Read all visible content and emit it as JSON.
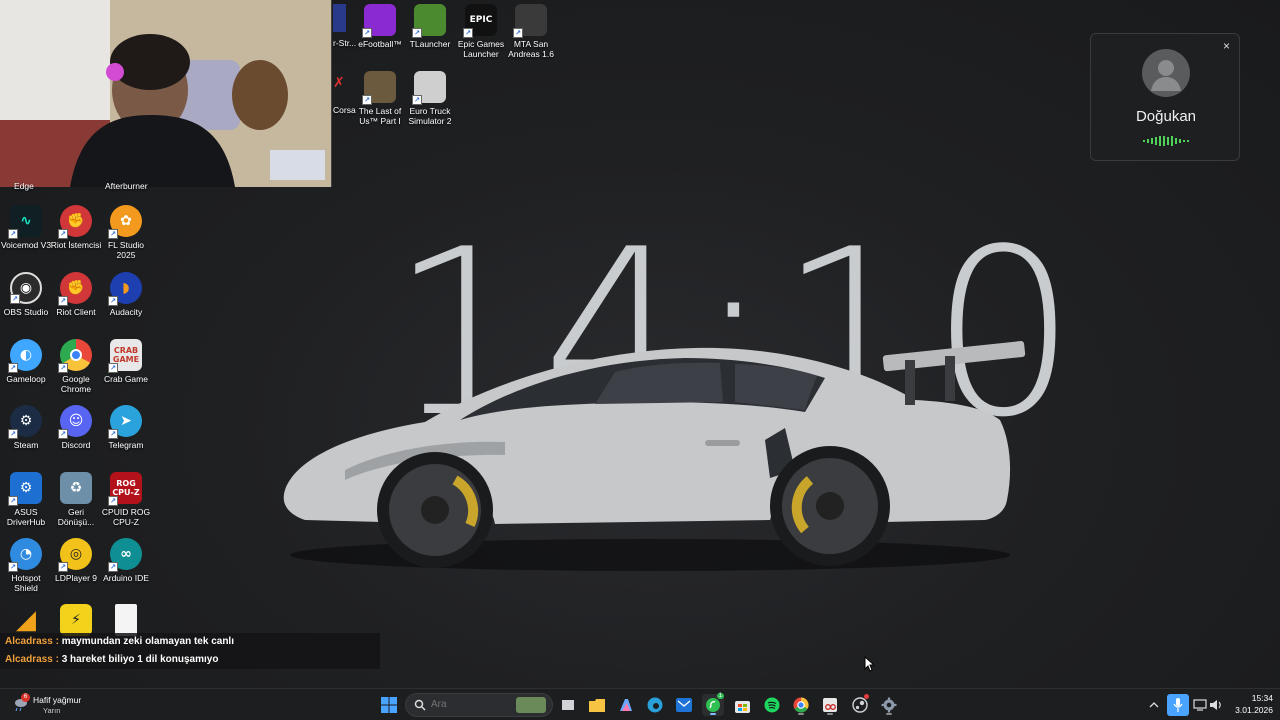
{
  "wallpaper": {
    "clock_text": "14:10"
  },
  "webcam": {
    "label": "webcam-overlay"
  },
  "desktop_icons": [
    {
      "id": "efootball",
      "label": "eFootball™",
      "color": "#8a2bd2"
    },
    {
      "id": "tlauncher",
      "label": "TLauncher",
      "color": "#4c8a2f"
    },
    {
      "id": "epic",
      "label": "Epic Games Launcher",
      "color": "#111111",
      "glyph": "EPIC"
    },
    {
      "id": "mta",
      "label": "MTA San Andreas 1.6",
      "color": "#3a3a3a"
    },
    {
      "id": "tlou",
      "label": "The Last of Us™ Part I",
      "color": "#6b5a3e"
    },
    {
      "id": "ets2",
      "label": "Euro Truck Simulator 2",
      "color": "#cfcfcf"
    },
    {
      "id": "voicemod",
      "label": "Voicemod V3",
      "color": "#0f1f24"
    },
    {
      "id": "riot-istemcisi",
      "label": "Riot İstemcisi",
      "color": "#d13639"
    },
    {
      "id": "flstudio",
      "label": "FL Studio 2025",
      "color": "#f39a1e"
    },
    {
      "id": "obs",
      "label": "OBS Studio",
      "color": "#2b2b2b"
    },
    {
      "id": "riot-client",
      "label": "Riot Client",
      "color": "#d13639"
    },
    {
      "id": "audacity",
      "label": "Audacity",
      "color": "#1e3fb0"
    },
    {
      "id": "gameloop",
      "label": "Gameloop",
      "color": "#3fa7ff"
    },
    {
      "id": "chrome",
      "label": "Google Chrome",
      "color": "#e9473a"
    },
    {
      "id": "crabgame",
      "label": "Crab Game",
      "color": "#e8e8e8",
      "glyph": "CRAB GAME"
    },
    {
      "id": "steam",
      "label": "Steam",
      "color": "#1b2c44"
    },
    {
      "id": "discord",
      "label": "Discord",
      "color": "#5865f2"
    },
    {
      "id": "telegram",
      "label": "Telegram",
      "color": "#2aa3dd"
    },
    {
      "id": "asus",
      "label": "ASUS DriverHub",
      "color": "#1d6fd1"
    },
    {
      "id": "recycle",
      "label": "Geri Dönüşü...",
      "color": "#6d8fa8"
    },
    {
      "id": "cpuz",
      "label": "CPUID ROG CPU-Z",
      "color": "#b3121a",
      "glyph": "ROG CPU-Z"
    },
    {
      "id": "hotspot",
      "label": "Hotspot Shield",
      "color": "#2e8be0"
    },
    {
      "id": "ldplayer",
      "label": "LDPlayer 9",
      "color": "#f2c21a"
    },
    {
      "id": "arduino",
      "label": "Arduino IDE",
      "color": "#0f8f94"
    },
    {
      "id": "unknown1",
      "label": "",
      "color": "#f0a21a"
    },
    {
      "id": "unknown2",
      "label": "",
      "color": "#f2d21a"
    },
    {
      "id": "unknown3",
      "label": "",
      "color": "#f4f4f4"
    }
  ],
  "partial_labels": {
    "edge": "Edge",
    "afterburner": "Afterburner",
    "str": "r-Str...",
    "corsa": "Corsa"
  },
  "call": {
    "name": "Doğukan",
    "close_glyph": "×"
  },
  "chat": [
    {
      "user": "Alcadrass",
      "sep": " : ",
      "msg": "maymundan zeki olamayan tek canlı"
    },
    {
      "user": "Alcadrass",
      "sep": " : ",
      "msg": "3 hareket biliyo 1 dil konuşamıyo"
    }
  ],
  "taskbar": {
    "weather": {
      "title": "Hafif yağmur",
      "sub": "Yarın",
      "badge": "6"
    },
    "search_placeholder": "Ara",
    "clock": {
      "time": "15:34",
      "date": "3.01.2026"
    },
    "icons": [
      "start-icon",
      "search-icon",
      "task-view-icon",
      "file-explorer-icon",
      "copilot-icon",
      "edge-icon",
      "outlook-icon",
      "whatsapp-icon",
      "store-icon",
      "spotify-icon",
      "chrome-icon",
      "snipping-tool-icon",
      "steam-icon",
      "settings-icon"
    ],
    "whatsapp_badge": "1"
  },
  "colors": {
    "accent": "#4aa3ff",
    "call_wave": "#4fd15a",
    "chat_user": "#f0a03a"
  }
}
